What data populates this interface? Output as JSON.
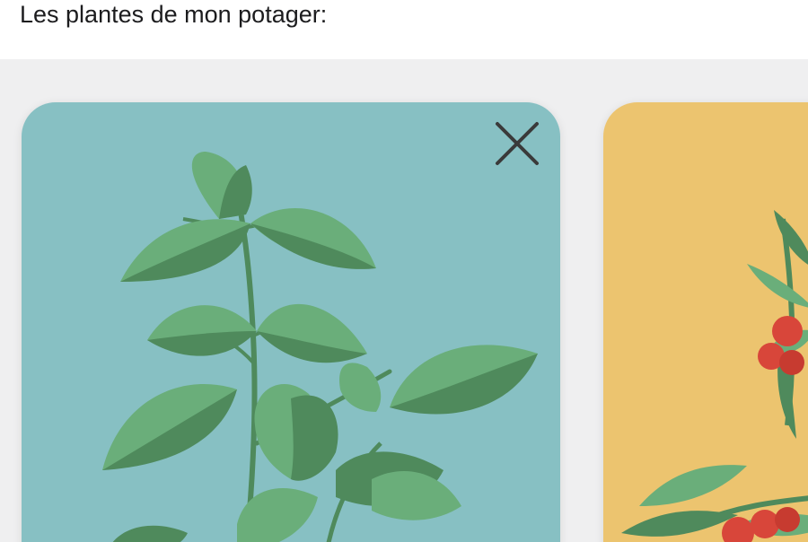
{
  "header": {
    "title": "Les plantes de mon potager:"
  },
  "cards": [
    {
      "plant": "basil",
      "background_color": "#87c0c3",
      "close_icon": "close-icon"
    },
    {
      "plant": "cherry-tomato",
      "background_color": "#ecc46f"
    }
  ],
  "colors": {
    "leaf_light": "#6aae7a",
    "leaf_dark": "#4f8a5c",
    "stem": "#4f8a5c",
    "tomato_red": "#d8463a",
    "close_icon": "#3a3a3a"
  }
}
